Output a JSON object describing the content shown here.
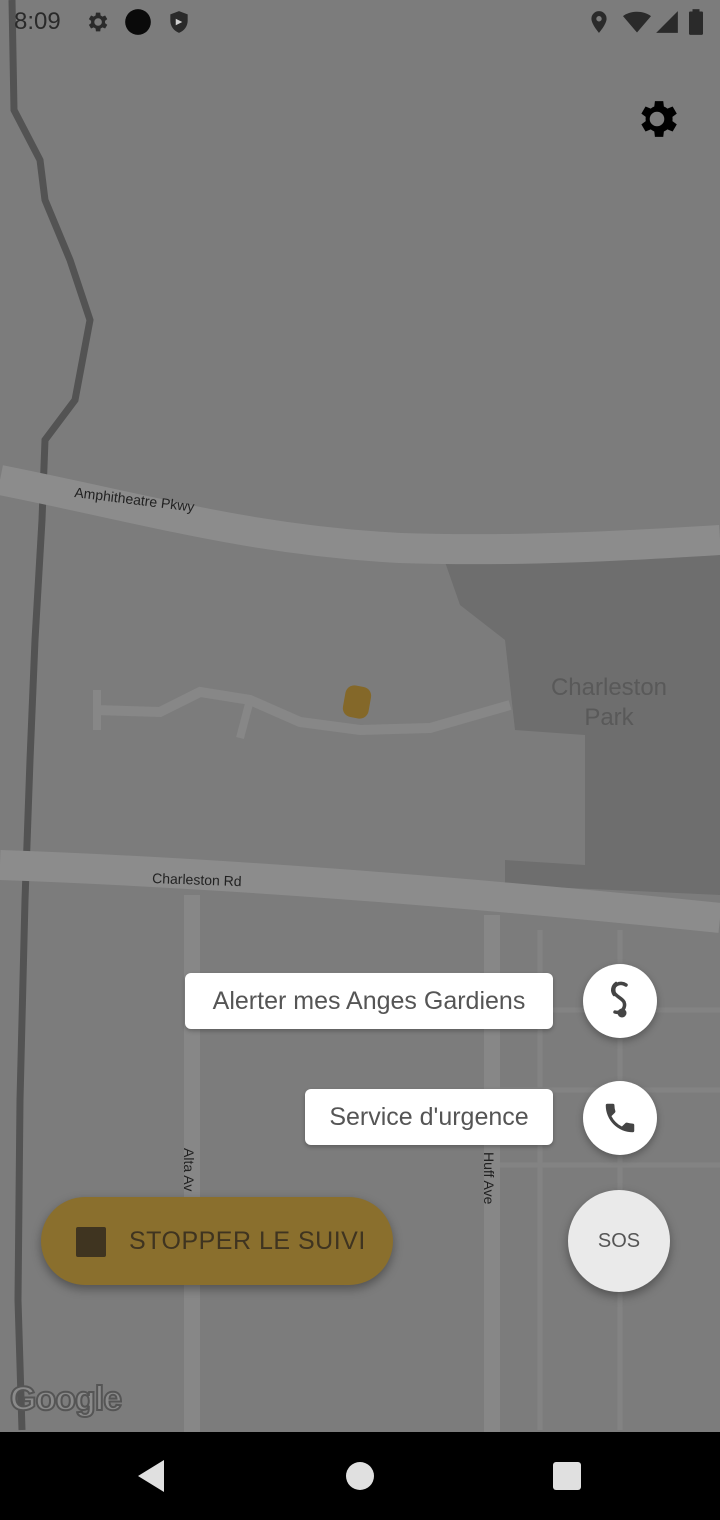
{
  "status_bar": {
    "time": "8:09",
    "left_icons": [
      "gear-icon",
      "circle-icon",
      "shield-icon"
    ],
    "right_icons": [
      "location-icon",
      "wifi-icon",
      "signal-icon",
      "battery-icon"
    ]
  },
  "map": {
    "labels": {
      "amphitheatre": "Amphitheatre Pkwy",
      "park_line1": "Charleston",
      "park_line2": "Park",
      "charleston_rd": "Charleston Rd",
      "alta": "Alta Av",
      "huff": "Huff Ave"
    },
    "attribution": "Google"
  },
  "actions": {
    "alert_label": "Alerter mes Anges Gardiens",
    "emergency_label": "Service d'urgence",
    "sos_label": "SOS",
    "stop_label": "STOPPER LE SUIVI"
  },
  "colors": {
    "accent": "#8a6f2d",
    "marker": "#a6801e"
  }
}
